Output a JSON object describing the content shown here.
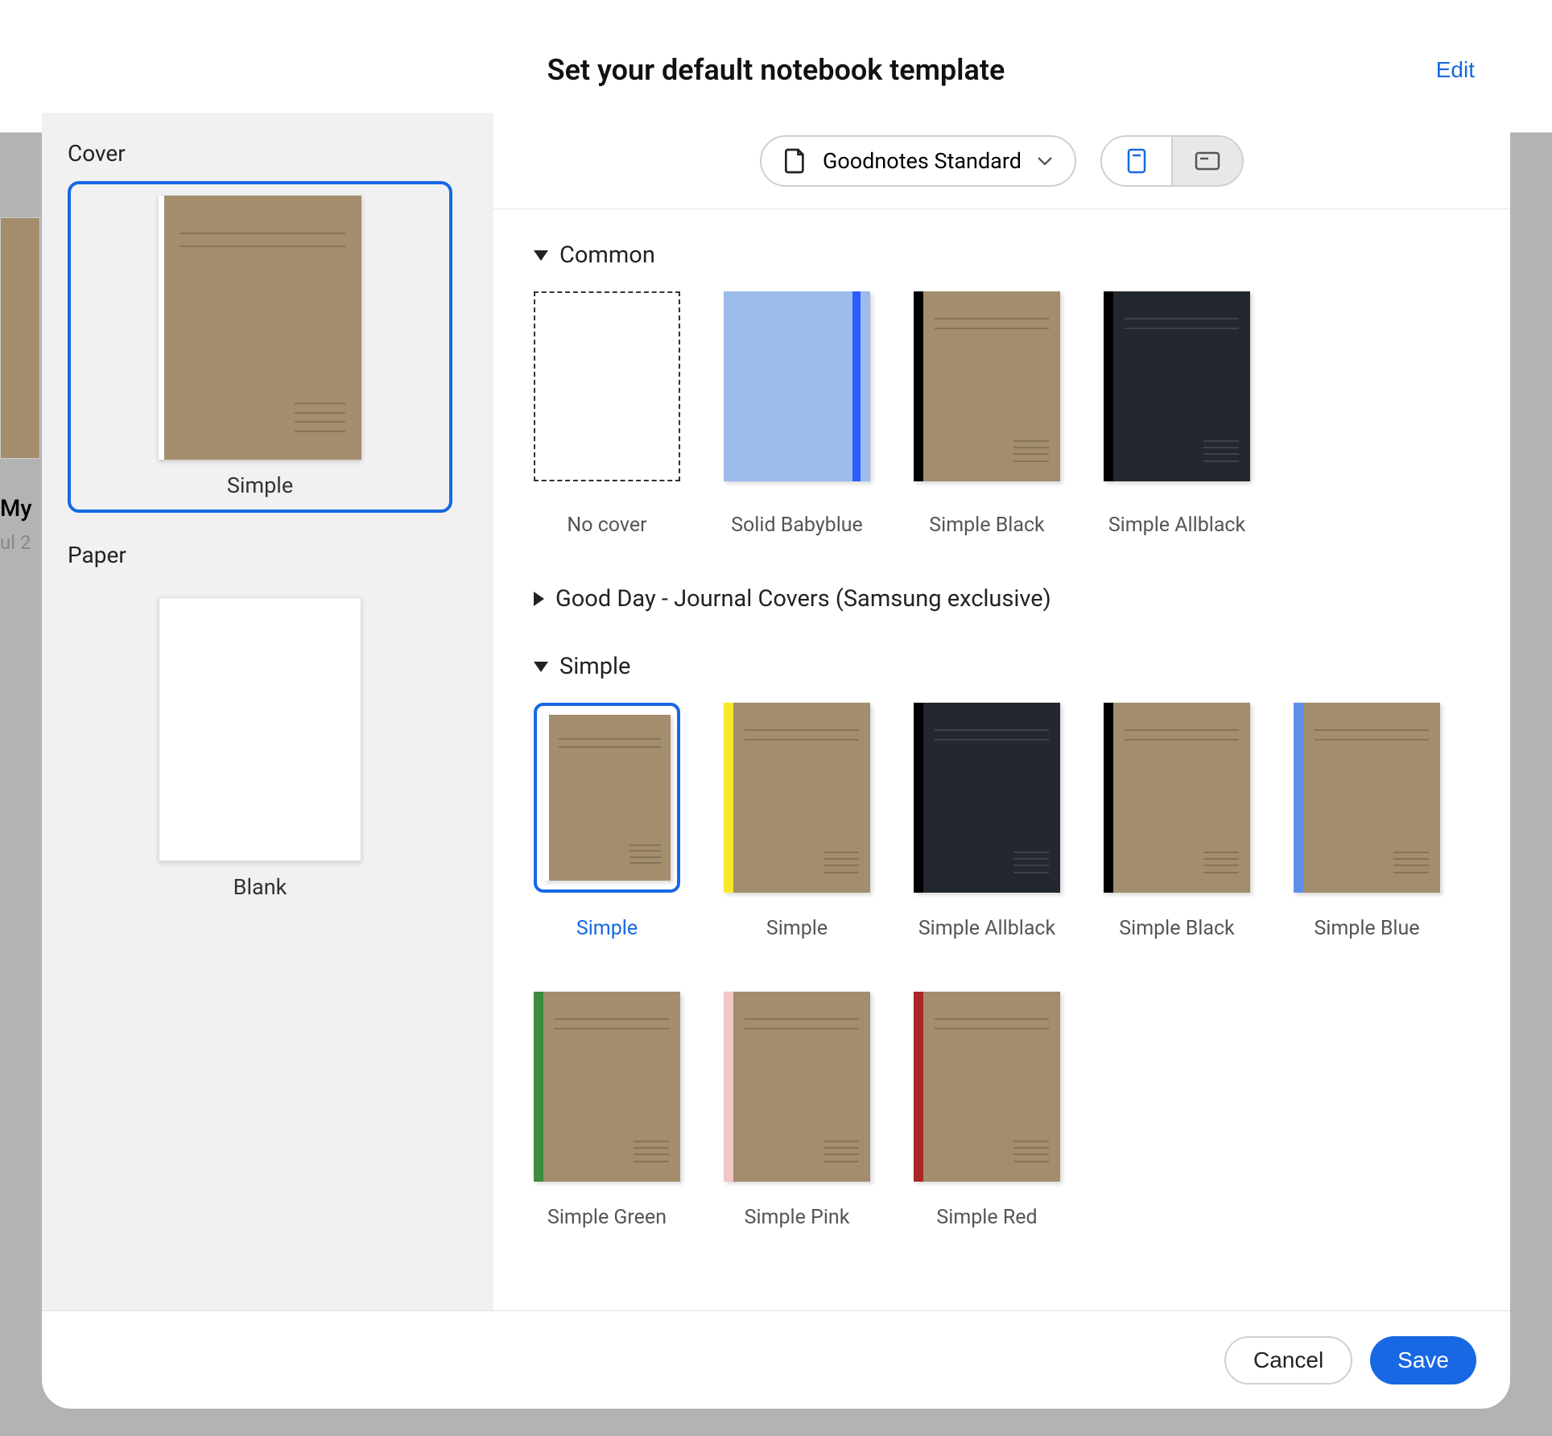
{
  "modal": {
    "title": "Set your default notebook template",
    "edit": "Edit"
  },
  "background": {
    "title_partial": "My",
    "date_partial": "ul 2"
  },
  "sidebar": {
    "cover_section": "Cover",
    "paper_section": "Paper",
    "cover_selected_label": "Simple",
    "paper_label": "Blank"
  },
  "controls": {
    "size_label": "Goodnotes Standard"
  },
  "categories": {
    "common": {
      "title": "Common",
      "expanded": true,
      "items": [
        {
          "label": "No cover",
          "type": "no-cover"
        },
        {
          "label": "Solid Babyblue",
          "type": "solid",
          "body": "#9CBCEB",
          "spine": "#2B5BFF"
        },
        {
          "label": "Simple Black",
          "type": "nb",
          "body": "#A38D6D",
          "spine": "#000000"
        },
        {
          "label": "Simple Allblack",
          "type": "nb",
          "body": "#23272F",
          "spine": "#000000",
          "light": true
        }
      ]
    },
    "goodday": {
      "title": "Good Day - Journal Covers (Samsung exclusive)",
      "expanded": false
    },
    "simple": {
      "title": "Simple",
      "expanded": true,
      "items": [
        {
          "label": "Simple",
          "type": "nb",
          "body": "#A38D6D",
          "spine": "#FFFFFF",
          "selected": true
        },
        {
          "label": "Simple",
          "type": "nb",
          "body": "#A38D6D",
          "spine": "#FAE72A"
        },
        {
          "label": "Simple Allblack",
          "type": "nb",
          "body": "#23272F",
          "spine": "#000000",
          "light": true
        },
        {
          "label": "Simple Black",
          "type": "nb",
          "body": "#A38D6D",
          "spine": "#000000"
        },
        {
          "label": "Simple Blue",
          "type": "nb",
          "body": "#A38D6D",
          "spine": "#5E8FE6"
        },
        {
          "label": "Simple Green",
          "type": "nb",
          "body": "#A38D6D",
          "spine": "#3E8A3E"
        },
        {
          "label": "Simple Pink",
          "type": "nb",
          "body": "#A38D6D",
          "spine": "#F2C6C6"
        },
        {
          "label": "Simple Red",
          "type": "nb",
          "body": "#A38D6D",
          "spine": "#A82727"
        }
      ]
    }
  },
  "footer": {
    "cancel": "Cancel",
    "save": "Save"
  }
}
